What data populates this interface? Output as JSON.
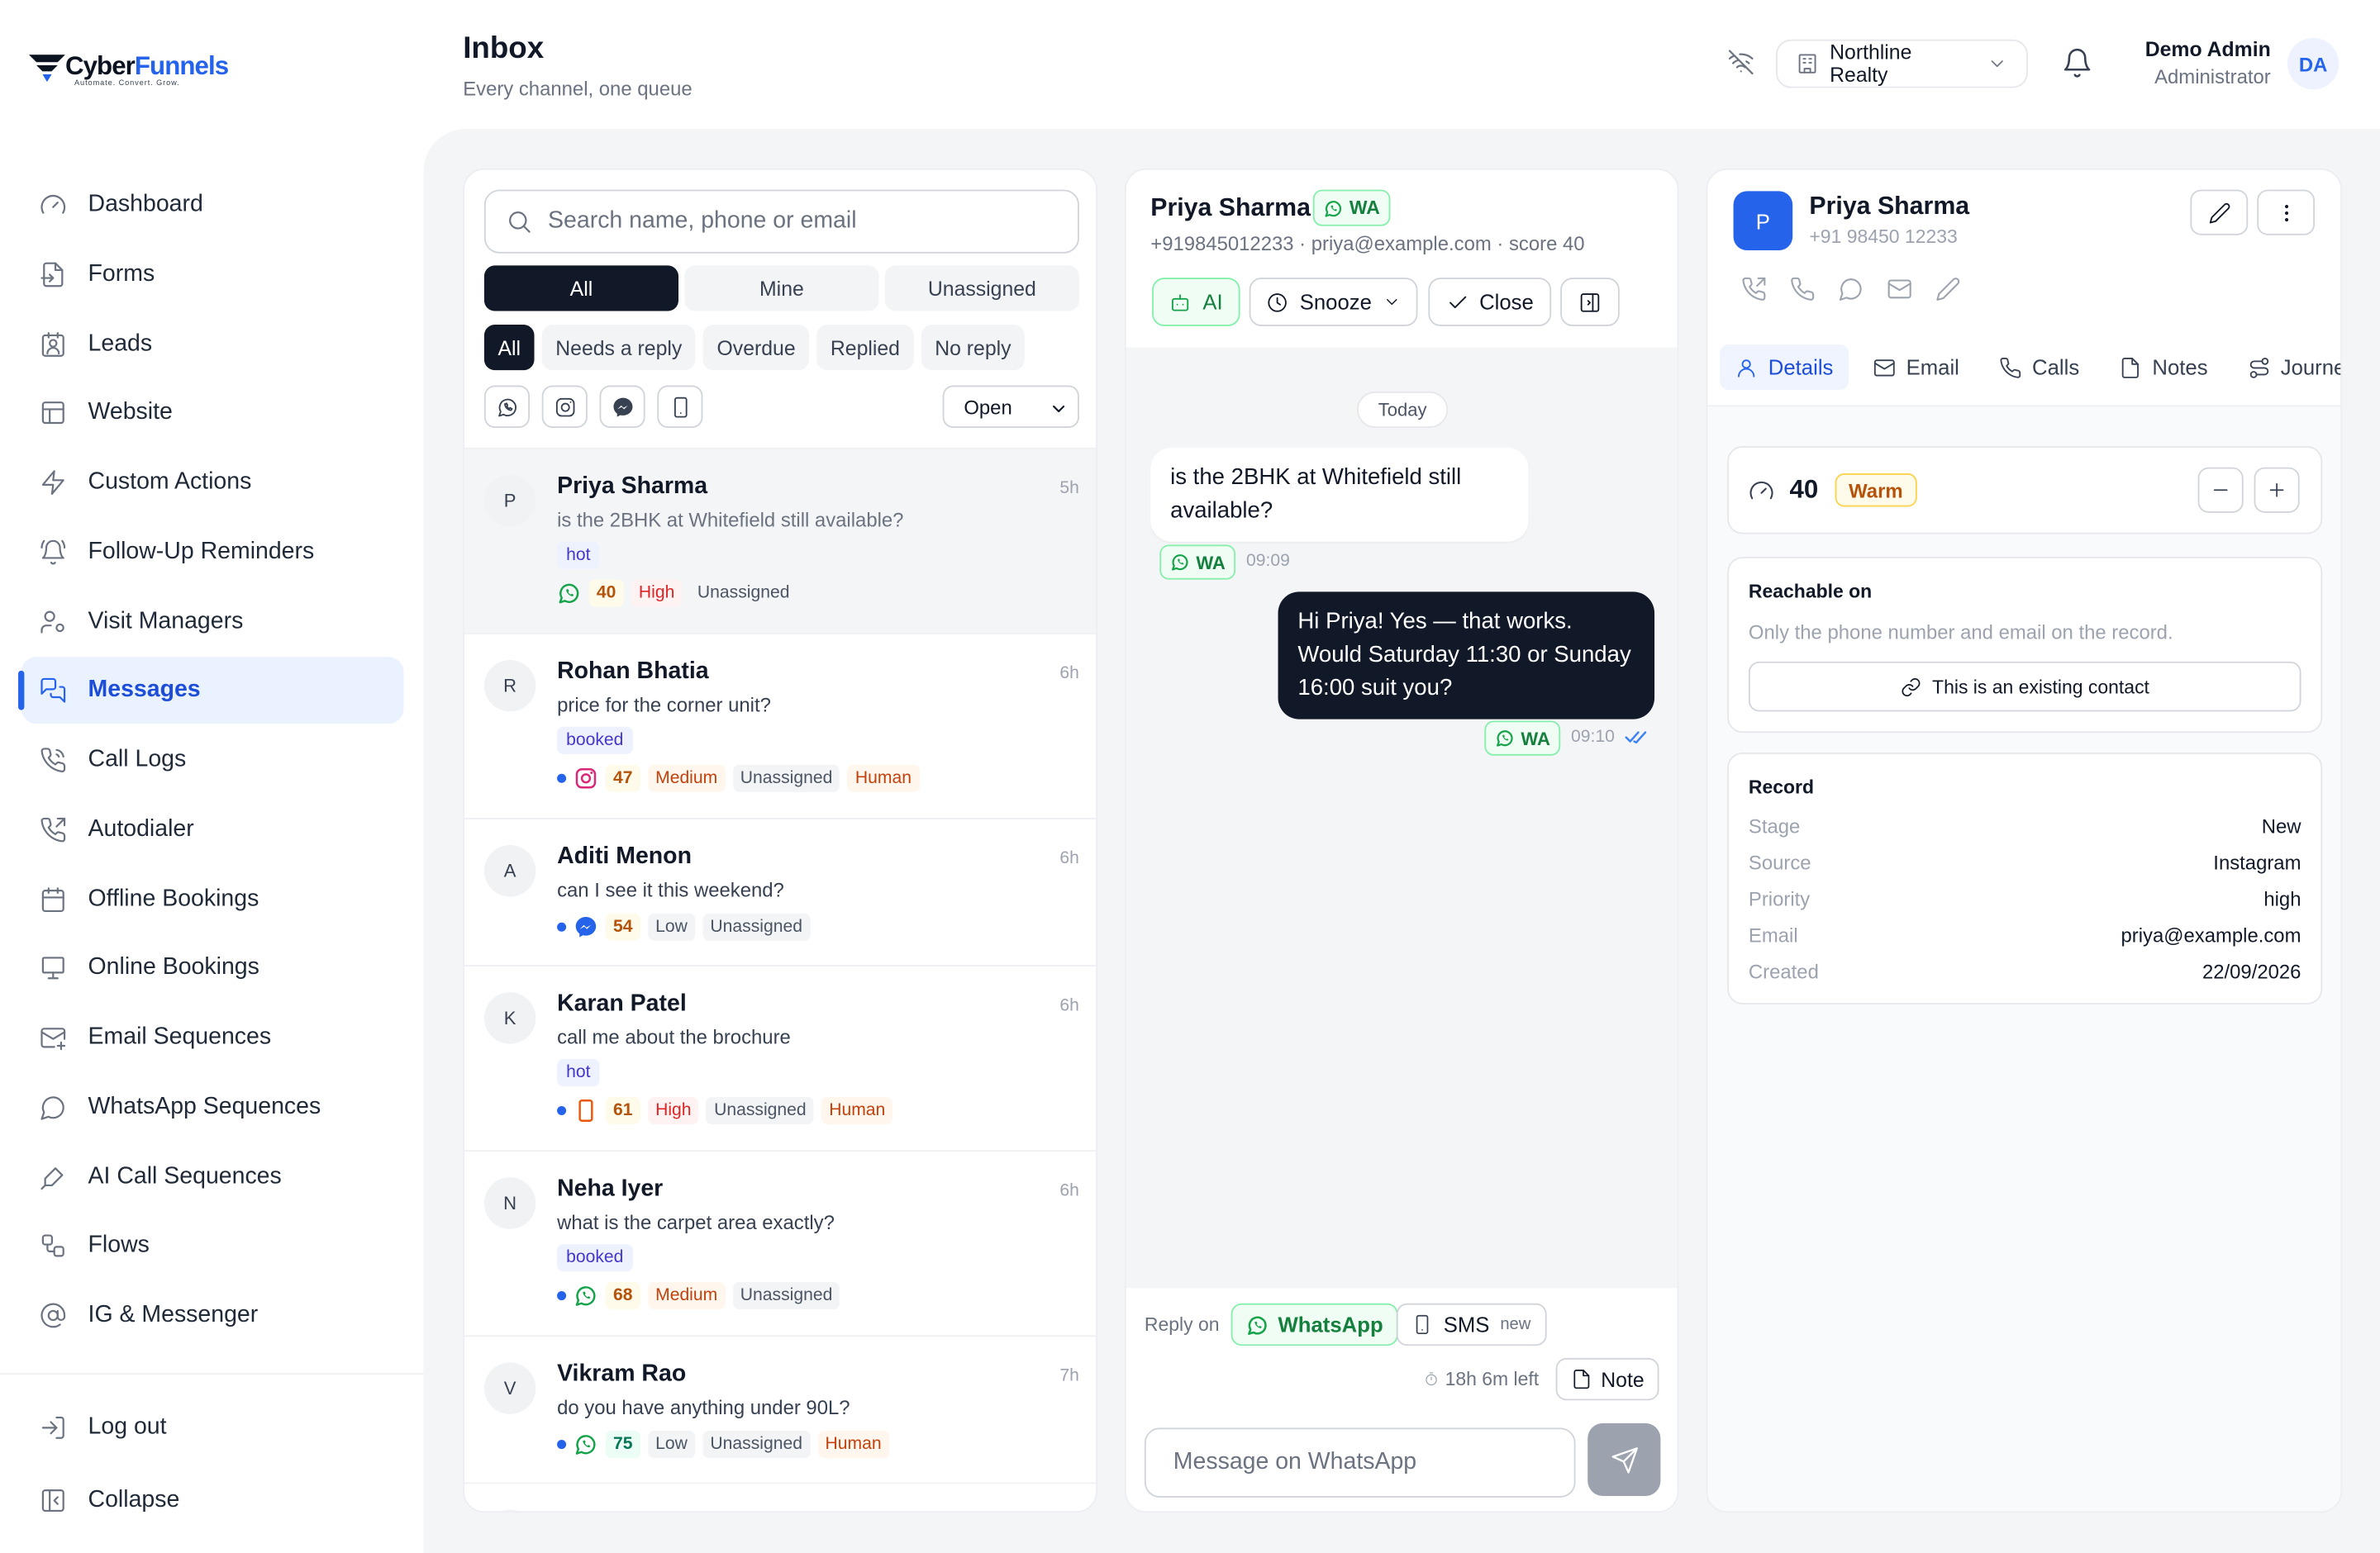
{
  "brand": {
    "name_a": "Cyber",
    "name_b": "Funnels",
    "tagline": "Automate. Convert. Grow."
  },
  "header": {
    "title": "Inbox",
    "subtitle": "Every channel, one queue",
    "org": "Northline Realty",
    "user_name": "Demo Admin",
    "user_role": "Administrator",
    "user_initials": "DA"
  },
  "sidebar": {
    "items": [
      {
        "label": "Dashboard",
        "icon": "gauge-icon"
      },
      {
        "label": "Forms",
        "icon": "form-icon"
      },
      {
        "label": "Leads",
        "icon": "contact-icon"
      },
      {
        "label": "Website",
        "icon": "layout-icon"
      },
      {
        "label": "Custom Actions",
        "icon": "zap-icon"
      },
      {
        "label": "Follow-Up Reminders",
        "icon": "bell-ring-icon"
      },
      {
        "label": "Visit Managers",
        "icon": "user-cog-icon"
      },
      {
        "label": "Messages",
        "icon": "messages-icon",
        "active": true
      },
      {
        "label": "Call Logs",
        "icon": "phone-icon"
      },
      {
        "label": "Autodialer",
        "icon": "phone-outgoing-icon"
      },
      {
        "label": "Offline Bookings",
        "icon": "calendar-icon"
      },
      {
        "label": "Online Bookings",
        "icon": "monitor-icon"
      },
      {
        "label": "Email Sequences",
        "icon": "mail-icon"
      },
      {
        "label": "WhatsApp Sequences",
        "icon": "chat-bubble-icon"
      },
      {
        "label": "AI Call Sequences",
        "icon": "mic-icon"
      },
      {
        "label": "Flows",
        "icon": "workflow-icon"
      },
      {
        "label": "IG & Messenger",
        "icon": "at-sign-icon"
      }
    ],
    "logout": "Log out",
    "collapse": "Collapse"
  },
  "list": {
    "search_placeholder": "Search name, phone or email",
    "assign_tabs": [
      "All",
      "Mine",
      "Unassigned"
    ],
    "filters": [
      "All",
      "Needs a reply",
      "Overdue",
      "Replied",
      "No reply"
    ],
    "status_select": "Open",
    "conversations": [
      {
        "initial": "P",
        "name": "Priya Sharma",
        "time": "5h",
        "msg": "is the 2BHK at Whitefield still available?",
        "tag": "hot",
        "channel": "whatsapp",
        "score": "40",
        "priority": "High",
        "assignee": "Unassigned",
        "human": "",
        "unread": false
      },
      {
        "initial": "R",
        "name": "Rohan Bhatia",
        "time": "6h",
        "msg": "price for the corner unit?",
        "tag": "booked",
        "channel": "instagram",
        "score": "47",
        "priority": "Medium",
        "assignee": "Unassigned",
        "human": "Human",
        "unread": true
      },
      {
        "initial": "A",
        "name": "Aditi Menon",
        "time": "6h",
        "msg": "can I see it this weekend?",
        "tag": "",
        "channel": "messenger",
        "score": "54",
        "priority": "Low",
        "assignee": "Unassigned",
        "human": "",
        "unread": true
      },
      {
        "initial": "K",
        "name": "Karan Patel",
        "time": "6h",
        "msg": "call me about the brochure",
        "tag": "hot",
        "channel": "sms",
        "score": "61",
        "priority": "High",
        "assignee": "Unassigned",
        "human": "Human",
        "unread": true
      },
      {
        "initial": "N",
        "name": "Neha Iyer",
        "time": "6h",
        "msg": "what is the carpet area exactly?",
        "tag": "booked",
        "channel": "whatsapp",
        "score": "68",
        "priority": "Medium",
        "assignee": "Unassigned",
        "human": "",
        "unread": true
      },
      {
        "initial": "V",
        "name": "Vikram Rao",
        "time": "7h",
        "msg": "do you have anything under 90L?",
        "tag": "",
        "channel": "whatsapp",
        "score": "75",
        "priority": "Low",
        "assignee": "Unassigned",
        "human": "Human",
        "unread": true
      }
    ]
  },
  "chat": {
    "name": "Priya Sharma",
    "channel_badge": "WA",
    "subline": "+919845012233 · priya@example.com · score 40",
    "actions": {
      "ai": "AI",
      "snooze": "Snooze",
      "close": "Close"
    },
    "day": "Today",
    "messages": [
      {
        "dir": "in",
        "text": "is the 2BHK at Whitefield still available?",
        "channel": "WA",
        "time": "09:09"
      },
      {
        "dir": "out",
        "text": "Hi Priya! Yes — that works. Would Saturday 11:30 or Sunday 16:00 suit you?",
        "channel": "WA",
        "time": "09:10"
      }
    ],
    "reply_on": "Reply on",
    "reply_whatsapp": "WhatsApp",
    "reply_sms": "SMS",
    "reply_sms_badge": "new",
    "window_left": "18h 6m left",
    "note": "Note",
    "input_placeholder": "Message on WhatsApp"
  },
  "contact": {
    "initial": "P",
    "name": "Priya Sharma",
    "phone": "+91 98450 12233",
    "tabs": [
      "Details",
      "Email",
      "Calls",
      "Notes",
      "Journey"
    ],
    "score": "40",
    "temperature": "Warm",
    "reachable_title": "Reachable on",
    "reachable_desc": "Only the phone number and email on the record.",
    "existing_contact": "This is an existing contact",
    "record_title": "Record",
    "record": [
      {
        "k": "Stage",
        "v": "New"
      },
      {
        "k": "Source",
        "v": "Instagram"
      },
      {
        "k": "Priority",
        "v": "high"
      },
      {
        "k": "Email",
        "v": "priya@example.com"
      },
      {
        "k": "Created",
        "v": "22/09/2026"
      }
    ]
  },
  "colors": {
    "accent": "#2563eb",
    "dark": "#111827",
    "whatsapp": "#16a34a",
    "instagram": "#db2777",
    "messenger": "#2563eb",
    "sms": "#ea580c"
  }
}
